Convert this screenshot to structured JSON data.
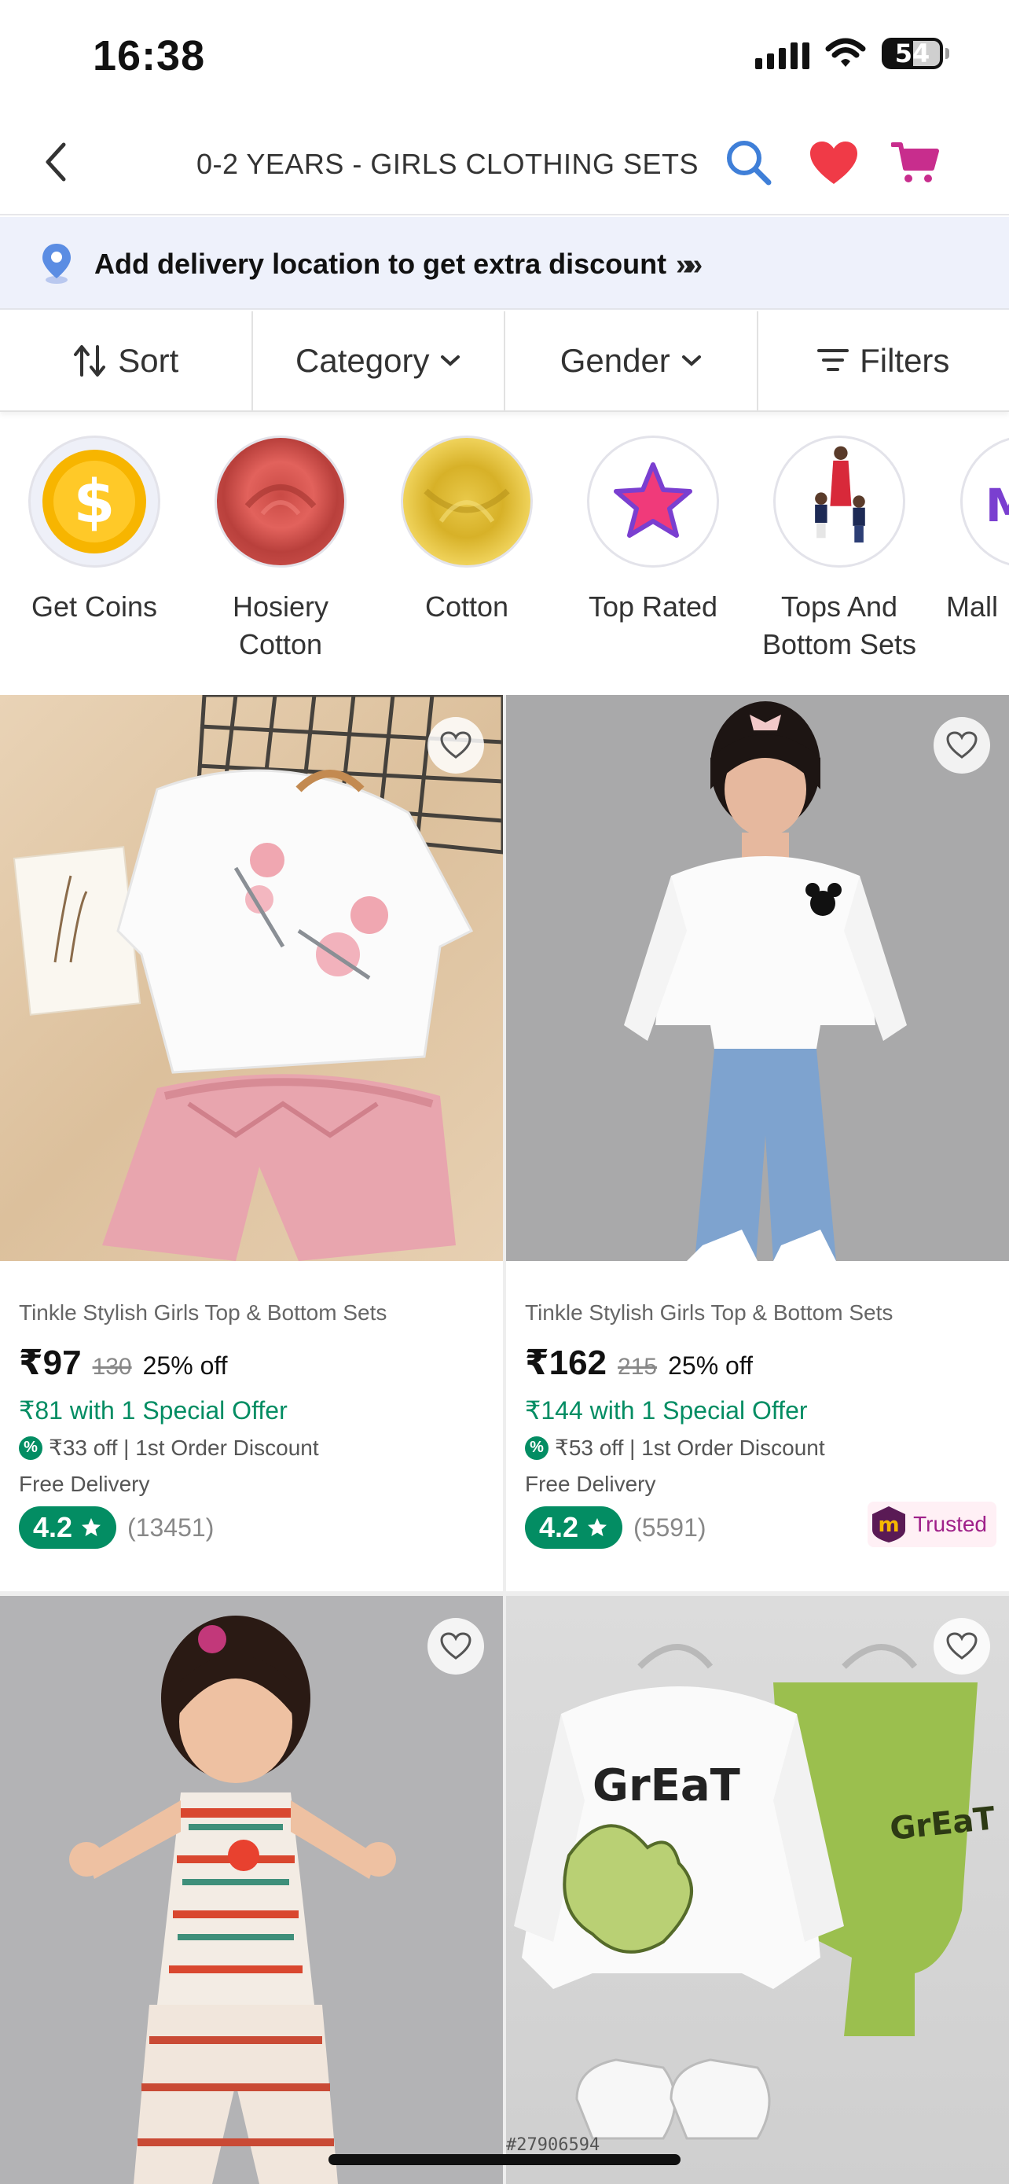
{
  "status_bar": {
    "time": "16:38",
    "battery": "54"
  },
  "header": {
    "title": "0-2 YEARS - GIRLS CLOTHING SETS",
    "icons": [
      "back-icon",
      "search-icon",
      "heart-icon",
      "cart-icon"
    ]
  },
  "delivery_banner": {
    "text": "Add delivery location to get extra discount",
    "chevron": "»»"
  },
  "filters": {
    "sort": "Sort",
    "category": "Category",
    "gender": "Gender",
    "filters": "Filters"
  },
  "chips": [
    {
      "label": "Get Coins"
    },
    {
      "label": "Hosiery Cotton"
    },
    {
      "label": "Cotton"
    },
    {
      "label": "Top Rated"
    },
    {
      "label": "Tops And Bottom Sets"
    },
    {
      "label": "Mall"
    }
  ],
  "products": [
    {
      "name": "Tinkle Stylish Girls Top & Bottom Sets",
      "price": "₹97",
      "mrp": "130",
      "discount": "25% off",
      "special_offer": "₹81 with 1 Special Offer",
      "first_order": "₹33 off | 1st Order Discount",
      "delivery": "Free Delivery",
      "rating": "4.2",
      "reviews": "(13451)"
    },
    {
      "name": "Tinkle Stylish Girls Top & Bottom Sets",
      "price": "₹162",
      "mrp": "215",
      "discount": "25% off",
      "special_offer": "₹144 with 1 Special Offer",
      "first_order": "₹53 off | 1st Order Discount",
      "delivery": "Free Delivery",
      "rating": "4.2",
      "reviews": "(5591)",
      "badge": "Trusted"
    }
  ],
  "image_code": "#27906594",
  "colors": {
    "green": "#038d63",
    "brand_pink": "#9f2089",
    "heart_red": "#f03a47",
    "search_blue": "#3f7fd8"
  }
}
